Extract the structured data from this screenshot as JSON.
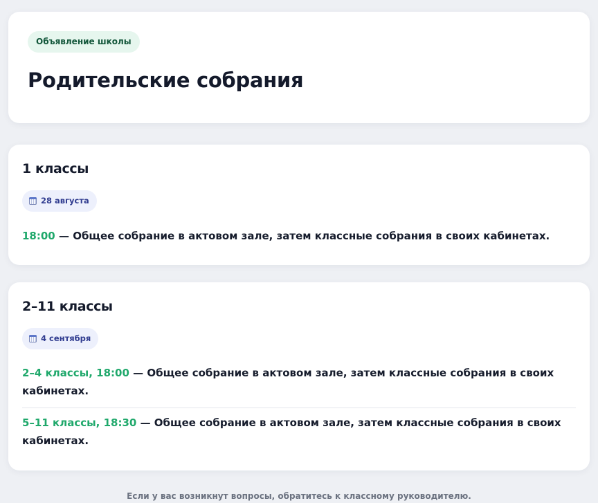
{
  "header": {
    "badge": "Объявление школы",
    "title": "Родительские собрания"
  },
  "sections": [
    {
      "title": "1 классы",
      "date": "28 августа",
      "meetings": [
        {
          "time": "18:00",
          "text": " — Общее собрание в актовом зале, затем классные собрания в своих кабинетах."
        }
      ]
    },
    {
      "title": "2–11 классы",
      "date": "4 сентября",
      "meetings": [
        {
          "time": "2–4 классы, 18:00",
          "text": " — Общее собрание в актовом зале, затем классные собрания в своих кабинетах."
        },
        {
          "time": "5–11 классы, 18:30",
          "text": " — Общее собрание в актовом зале, затем классные собрания в своих кабинетах."
        }
      ]
    }
  ],
  "footer": {
    "note": "Если у вас возникнут вопросы, обратитесь к классному руководителю."
  },
  "icons": {
    "date_icon": "calendar-icon"
  },
  "colors": {
    "accent_time": "#1fa86b",
    "badge_bg": "#e6f6ee",
    "date_pill_bg": "#edf0fc"
  }
}
